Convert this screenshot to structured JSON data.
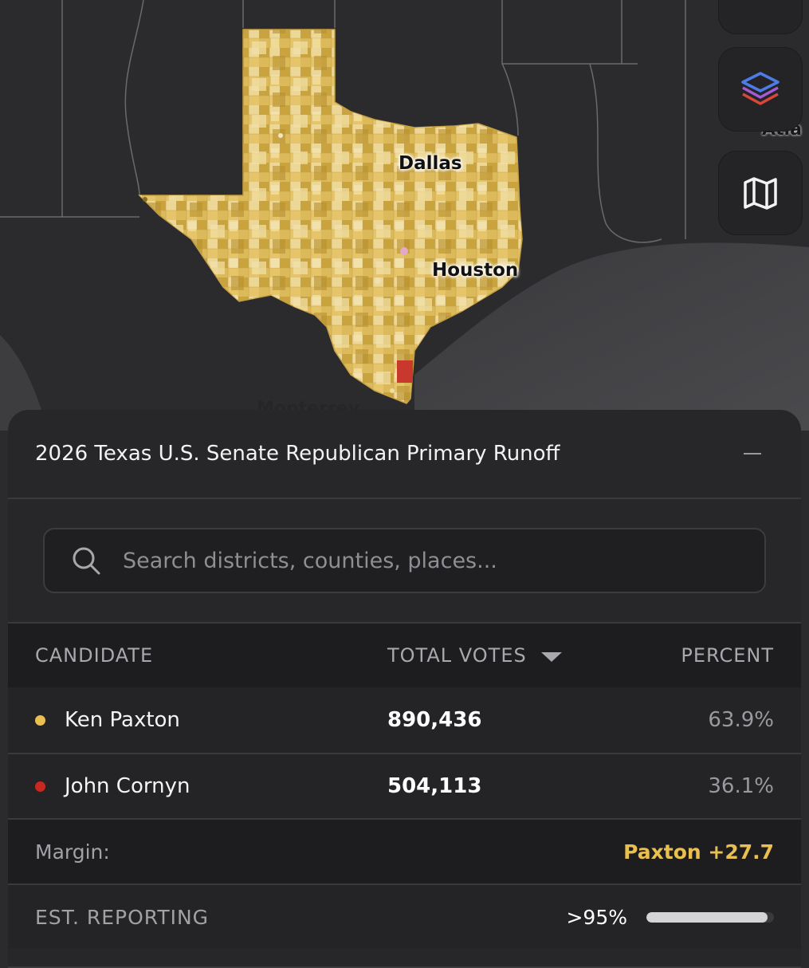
{
  "map": {
    "city_labels": [
      "Dallas",
      "Houston"
    ],
    "partial_labels": [
      "Monterrey",
      "Atla"
    ],
    "colors": {
      "background": "#2b2b2e",
      "land": "#2e2e31",
      "gulf": "#444447",
      "paxton_fill": "#d9b350",
      "cornyn_fill": "#c8382d"
    }
  },
  "map_controls": [
    {
      "name": "table-icon"
    },
    {
      "name": "layers-icon"
    },
    {
      "name": "map-icon"
    }
  ],
  "panel": {
    "title": "2026 Texas U.S. Senate Republican Primary Runoff",
    "collapse_icon": "minus-icon",
    "search": {
      "placeholder": "Search districts, counties, places...",
      "icon": "search-icon"
    },
    "table": {
      "headers": {
        "candidate": "CANDIDATE",
        "total_votes": "TOTAL VOTES",
        "percent": "PERCENT"
      },
      "sort_icon": "caret-down-icon",
      "rows": [
        {
          "candidate": "Ken Paxton",
          "votes": "890,436",
          "percent": "63.9%",
          "color": "#e9c04f"
        },
        {
          "candidate": "John Cornyn",
          "votes": "504,113",
          "percent": "36.1%",
          "color": "#c8281f"
        }
      ]
    },
    "margin": {
      "label": "Margin:",
      "value": "Paxton +27.7",
      "color": "#e9c04f"
    },
    "reporting": {
      "label": "EST. REPORTING",
      "value": ">95%",
      "fraction": 0.95
    }
  }
}
